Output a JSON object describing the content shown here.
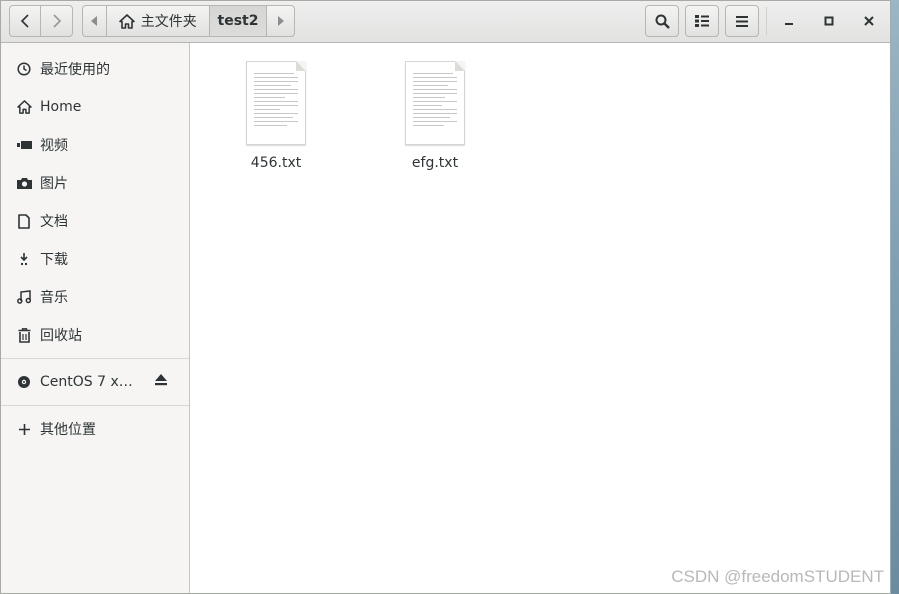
{
  "toolbar": {
    "path_home_label": "主文件夹",
    "path_current_label": "test2"
  },
  "sidebar": {
    "items": [
      {
        "label": "最近使用的",
        "icon": "clock-icon"
      },
      {
        "label": "Home",
        "icon": "home-icon"
      },
      {
        "label": "视频",
        "icon": "video-icon"
      },
      {
        "label": "图片",
        "icon": "camera-icon"
      },
      {
        "label": "文档",
        "icon": "document-icon"
      },
      {
        "label": "下载",
        "icon": "download-icon"
      },
      {
        "label": "音乐",
        "icon": "music-icon"
      },
      {
        "label": "回收站",
        "icon": "trash-icon"
      }
    ],
    "devices": [
      {
        "label": "CentOS 7 x…",
        "icon": "disc-icon",
        "action_icon": "eject-icon"
      }
    ],
    "other": {
      "label": "其他位置",
      "icon": "plus-icon"
    }
  },
  "files": [
    {
      "name": "456.txt",
      "icon": "text-file-icon"
    },
    {
      "name": "efg.txt",
      "icon": "text-file-icon"
    }
  ],
  "watermark": "CSDN @freedomSTUDENT"
}
